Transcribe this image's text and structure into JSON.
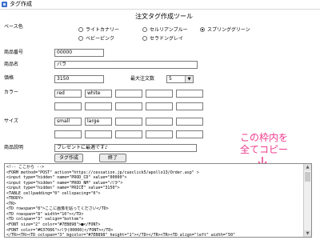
{
  "window": {
    "title": "タグ作成"
  },
  "page_title": "注文タグ作成ツール",
  "base_color": {
    "label": "ベース色",
    "options": [
      {
        "label": "ライトカナリー",
        "checked": false
      },
      {
        "label": "セルリアンブルー",
        "checked": false
      },
      {
        "label": "スプリンググリーン",
        "checked": true
      },
      {
        "label": "ベビーピンク",
        "checked": false
      },
      {
        "label": "セラドングレイ",
        "checked": false
      }
    ]
  },
  "product_code": {
    "label": "商品番号",
    "value": "00000"
  },
  "product_name": {
    "label": "商品名",
    "value": "バラ"
  },
  "price": {
    "label": "価格",
    "value": "3150"
  },
  "max_qty": {
    "label": "最大注文数",
    "value": "5"
  },
  "color": {
    "label": "カラー",
    "values": [
      "red",
      "white",
      "",
      "",
      "",
      "",
      "",
      "",
      "",
      ""
    ]
  },
  "size": {
    "label": "サイズ",
    "values": [
      "small",
      "large",
      "",
      "",
      "",
      "",
      "",
      "",
      "",
      ""
    ]
  },
  "description": {
    "label": "商品説明",
    "value": "プレゼントに最適です♪"
  },
  "buttons": {
    "create": "タグ作成",
    "exit": "終了"
  },
  "annotation": {
    "line1": "この枠内を",
    "line2": "全てコピー"
  },
  "code_lines": [
    "<!-- ここから -->",
    "<FORM method=\"POST\" action=\"https://cessation.jp/cueclick5/apollo13/Order.asp\" >",
    "<input type=\"hidden\" name=\"PROD_CD\" value=\"00000\">",
    "<input type=\"hidden\" name=\"PROD_NM\" value=\"バラ\">",
    "<input type=\"hidden\" name=\"PRICE\" value=\"3150\">",
    "<TABLE cellpadding=\"0\" cellspacing=\"0\">",
    "<TBODY>",
    "<TR>",
    "<TD rowspan=\"8\">ここに画像を貼ってください</TD>",
    "<TD rowspan=\"8\" width=\"10\"></TD>",
    "<TD colspan=\"3\" valign=\"bottom\">",
    "<FONT size=\"2\" color=\"#7EB898\">■</FONT>",
    "<FONT color=\"#637086\">バラ(00000)</FONT></TD>",
    "</TR><TR><TD colspan=\"3\" bgcolor=\"#7EB898\" height=\"1\"></TD></TR><TR><TD align=\"left\" width=\"50\""
  ]
}
